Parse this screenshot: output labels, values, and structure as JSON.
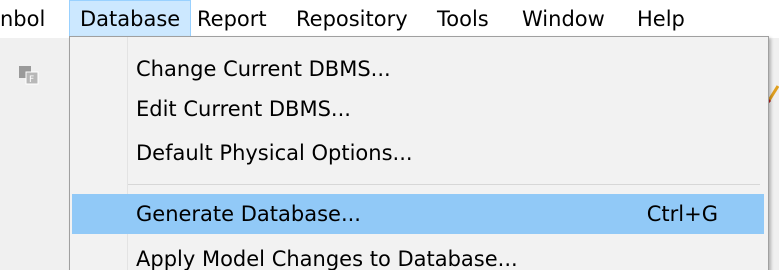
{
  "menubar": {
    "items": [
      {
        "label": "nbol"
      },
      {
        "label": "Database"
      },
      {
        "label": "Report"
      },
      {
        "label": "Repository"
      },
      {
        "label": "Tools"
      },
      {
        "label": "Window"
      },
      {
        "label": "Help"
      }
    ]
  },
  "toolbar": {
    "icons": [
      "format-icon",
      "pencil-icon"
    ]
  },
  "database_menu": {
    "items": [
      {
        "label": "Change Current DBMS...",
        "shortcut": ""
      },
      {
        "label": "Edit Current DBMS...",
        "shortcut": ""
      },
      {
        "label": "Default Physical Options...",
        "shortcut": ""
      },
      {
        "label": "Generate Database...",
        "shortcut": "Ctrl+G",
        "highlighted": true
      },
      {
        "label": "Apply Model Changes to Database...",
        "shortcut": ""
      }
    ]
  },
  "colors": {
    "menubar_active_bg": "#cce8ff",
    "menu_highlight_bg": "#91c9f7",
    "menu_bg": "#f2f2f2",
    "toolbar_bg": "#f0f0f0"
  }
}
